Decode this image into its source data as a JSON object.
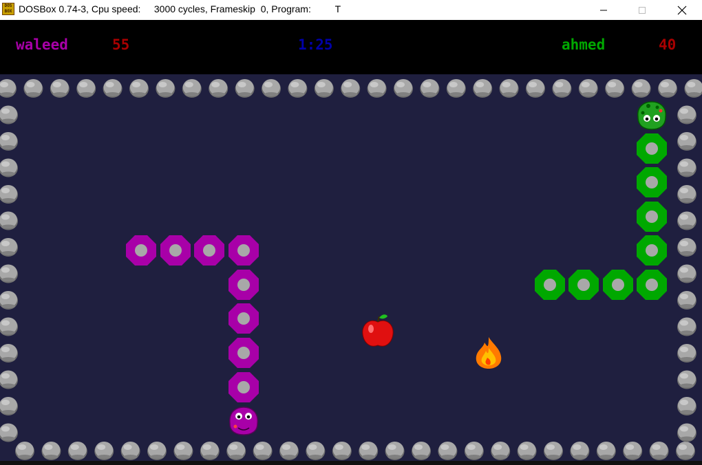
{
  "window": {
    "title": "DOSBox 0.74-3, Cpu speed:     3000 cycles, Frameskip  0, Program:         T",
    "icon_text": "DOS BOX"
  },
  "scoreboard": {
    "player1_name": "waleed",
    "player1_score": "55",
    "timer": "1:25",
    "player2_name": "ahmed",
    "player2_score": "40"
  },
  "colors": {
    "background": "#1f1f3f",
    "player1": "#a800a8",
    "player2": "#00a800",
    "timer": "#0000a8",
    "score": "#a80000",
    "rock": "#a0a0a0"
  },
  "items": {
    "apple": "apple-icon",
    "fire": "fire-icon"
  }
}
